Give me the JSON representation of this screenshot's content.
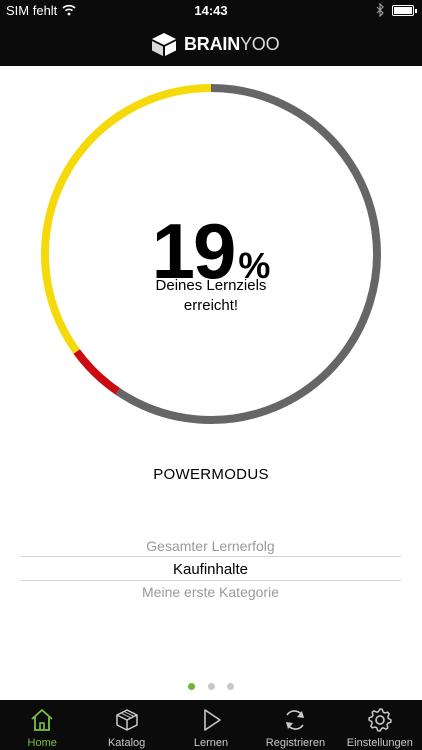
{
  "status_bar": {
    "carrier": "SIM fehlt",
    "time": "14:43"
  },
  "app": {
    "brand_bold": "BRAIN",
    "brand_light": "YOO"
  },
  "progress": {
    "percent_value": "19",
    "percent_sign": "%",
    "caption_line1": "Deines Lernziels",
    "caption_line2": "erreicht!",
    "segments": [
      {
        "name": "gelb",
        "fraction": 0.35,
        "color": "#f5d90a"
      },
      {
        "name": "rot",
        "fraction": 0.055,
        "color": "#cc0a14"
      },
      {
        "name": "grau",
        "fraction": 0.595,
        "color": "#666666"
      }
    ]
  },
  "mode_label": "POWERMODUS",
  "picker": {
    "items": [
      "Gesamter Lernerfolg",
      "Kaufinhalte",
      "Meine erste Kategorie"
    ],
    "selected_index": 1
  },
  "page_indicator": {
    "count": 3,
    "active_index": 0
  },
  "tabs": [
    {
      "label": "Home",
      "icon": "home-icon",
      "active": true
    },
    {
      "label": "Katalog",
      "icon": "catalog-box-icon",
      "active": false
    },
    {
      "label": "Lernen",
      "icon": "play-icon",
      "active": false
    },
    {
      "label": "Registrieren",
      "icon": "sync-icon",
      "active": false
    },
    {
      "label": "Einstellungen",
      "icon": "gear-icon",
      "active": false
    }
  ],
  "colors": {
    "accent": "#7bc043",
    "bar_background": "#0b0b0b"
  }
}
